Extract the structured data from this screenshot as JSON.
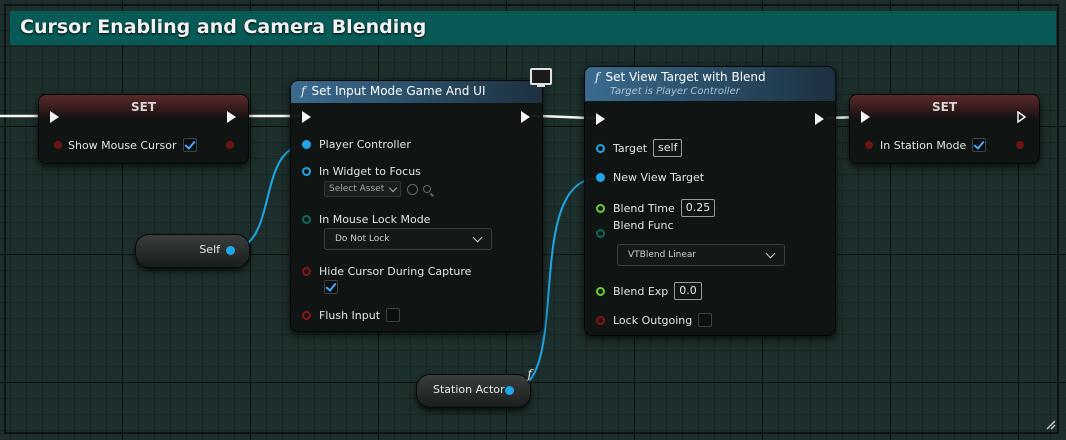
{
  "comment": {
    "title": "Cursor Enabling and Camera Blending"
  },
  "nodes": {
    "set_mouse_cursor": {
      "header": "SET",
      "pin_label": "Show Mouse Cursor",
      "checked": true
    },
    "set_input_mode": {
      "title": "Set Input Mode Game And UI",
      "pins": {
        "player_controller": "Player Controller",
        "widget_to_focus": "In Widget to Focus",
        "select_asset": "Select Asset",
        "mouse_lock_mode": "In Mouse Lock Mode",
        "mouse_lock_value": "Do Not Lock",
        "hide_cursor": "Hide Cursor During Capture",
        "flush_input": "Flush Input"
      },
      "hide_cursor_checked": true,
      "flush_input_checked": false
    },
    "set_view_target": {
      "title": "Set View Target with Blend",
      "subtitle": "Target is Player Controller",
      "pins": {
        "target": "Target",
        "target_value": "self",
        "new_view_target": "New View Target",
        "blend_time": "Blend Time",
        "blend_time_value": "0.25",
        "blend_func": "Blend Func",
        "blend_func_value": "VTBlend Linear",
        "blend_exp": "Blend Exp",
        "blend_exp_value": "0.0",
        "lock_outgoing": "Lock Outgoing"
      },
      "lock_outgoing_checked": false
    },
    "set_station_mode": {
      "header": "SET",
      "pin_label": "In Station Mode",
      "checked": true
    },
    "self_node": {
      "label": "Self"
    },
    "station_actor": {
      "label": "Station Actor"
    }
  },
  "colors": {
    "comment_bar": "#075a56",
    "exec_wire": "#f4f4f4",
    "object_pin": "#1fa6e8",
    "bool_pin": "#8c1414",
    "float_pin": "#6ccf35",
    "enum_pin": "#0d6b5b",
    "function_header": "#3a6b8f",
    "set_header": "#5a2a2a"
  }
}
